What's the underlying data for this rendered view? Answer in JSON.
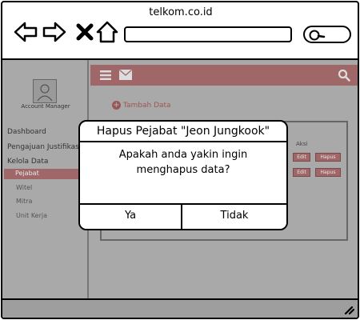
{
  "browser": {
    "url_title": "telkom.co.id",
    "url": "",
    "search": ""
  },
  "sidebar": {
    "role": "Account Manager",
    "items": [
      {
        "label": "Dashboard"
      },
      {
        "label": "Pengajuan Justifikasi"
      },
      {
        "label": "Kelola Data"
      }
    ],
    "sub_items": [
      {
        "label": "Pejabat",
        "active": true
      },
      {
        "label": "Witel"
      },
      {
        "label": "Mitra"
      },
      {
        "label": "Unit Kerja"
      }
    ]
  },
  "content": {
    "add_label": "Tambah Data",
    "aksi_header": "Aksi",
    "row_actions": [
      {
        "edit": "Edit",
        "delete": "Hapus"
      },
      {
        "edit": "Edit",
        "delete": "Hapus"
      }
    ]
  },
  "dialog": {
    "title": "Hapus Pejabat \"Jeon Jungkook\"",
    "message": "Apakah anda yakin ingin menghapus data?",
    "confirm_label": "Ya",
    "cancel_label": "Tidak"
  },
  "colors": {
    "accent": "#a06768",
    "overlay": "#a9a9a9"
  },
  "icons": {
    "back": "arrow-left-icon",
    "forward": "arrow-right-icon",
    "close": "close-icon",
    "home": "home-icon",
    "search": "search-icon",
    "menu": "hamburger-icon",
    "mail": "mail-icon",
    "resize": "resize-icon"
  }
}
